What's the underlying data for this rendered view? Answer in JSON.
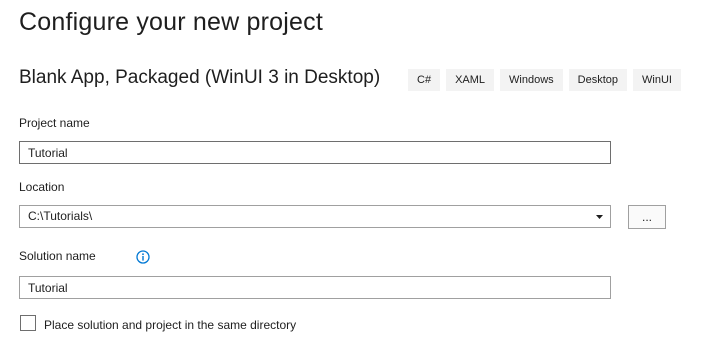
{
  "page": {
    "title": "Configure your new project"
  },
  "template": {
    "name": "Blank App, Packaged (WinUI 3 in Desktop)",
    "tags": [
      "C#",
      "XAML",
      "Windows",
      "Desktop",
      "WinUI"
    ]
  },
  "project_name": {
    "label": "Project name",
    "value": "Tutorial"
  },
  "location": {
    "label": "Location",
    "value": "C:\\Tutorials\\",
    "browse_label": "..."
  },
  "solution_name": {
    "label": "Solution name",
    "value": "Tutorial",
    "info_icon": "info-circle-icon"
  },
  "same_directory": {
    "label": "Place solution and project in the same directory",
    "checked": false
  },
  "colors": {
    "accent": "#0078d4",
    "border": "#a0a0a0",
    "tag_background": "#f3f3f3"
  }
}
